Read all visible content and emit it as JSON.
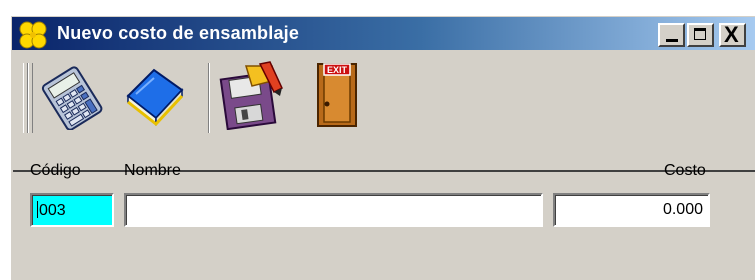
{
  "window": {
    "title": "Nuevo costo de ensamblaje",
    "controls": {
      "minimize": "_",
      "maximize": "□",
      "close": "X"
    },
    "titlebar_colors": [
      "#0a246a",
      "#3a6ea5",
      "#a6caf0"
    ]
  },
  "toolbar": {
    "buttons": [
      {
        "icon": "calculator-icon"
      },
      {
        "icon": "book-icon"
      },
      {
        "icon": "save-icon"
      },
      {
        "icon": "exit-door-icon",
        "badge": "EXIT"
      }
    ]
  },
  "form": {
    "code_label": "Código",
    "name_label": "Nombre",
    "cost_label": "Costo",
    "code_value": "003",
    "name_value": "",
    "cost_value": "0.000",
    "code_highlight_color": "#00ffff"
  }
}
